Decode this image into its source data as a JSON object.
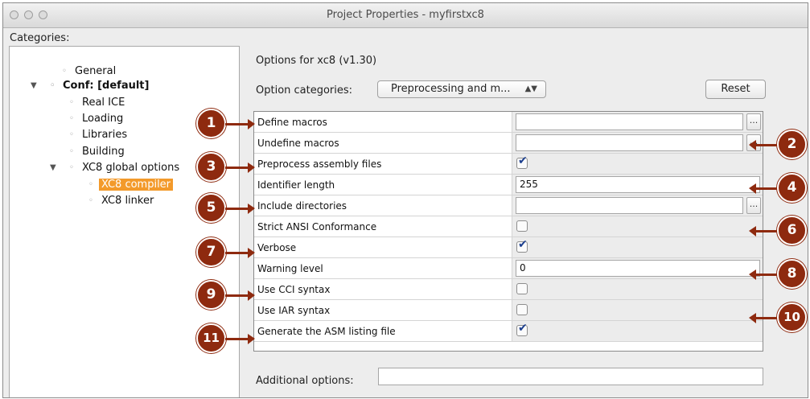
{
  "window": {
    "title": "Project Properties - myfirstxc8"
  },
  "categories": {
    "label": "Categories:",
    "items": [
      {
        "label": "General"
      },
      {
        "label": "Conf: [default]"
      },
      {
        "label": "Real ICE"
      },
      {
        "label": "Loading"
      },
      {
        "label": "Libraries"
      },
      {
        "label": "Building"
      },
      {
        "label": "XC8 global options"
      },
      {
        "label": "XC8 compiler"
      },
      {
        "label": "XC8 linker"
      }
    ]
  },
  "options": {
    "header": "Options for xc8 (v1.30)",
    "category_label": "Option categories:",
    "category_value": "Preprocessing and m...",
    "reset_label": "Reset",
    "rows": [
      {
        "label": "Define macros",
        "value": ""
      },
      {
        "label": "Undefine macros",
        "value": ""
      },
      {
        "label": "Preprocess assembly files",
        "checked": true
      },
      {
        "label": "Identifier length",
        "value": "255"
      },
      {
        "label": "Include directories",
        "value": ""
      },
      {
        "label": "Strict ANSI Conformance",
        "checked": false
      },
      {
        "label": "Verbose",
        "checked": true
      },
      {
        "label": "Warning level",
        "value": "0"
      },
      {
        "label": "Use CCI syntax",
        "checked": false
      },
      {
        "label": "Use IAR syntax",
        "checked": false
      },
      {
        "label": "Generate the ASM listing file",
        "checked": true
      }
    ],
    "browse_label": "...",
    "additional_label": "Additional options:",
    "additional_value": ""
  },
  "callouts": [
    "1",
    "2",
    "3",
    "4",
    "5",
    "6",
    "7",
    "8",
    "9",
    "10",
    "11"
  ],
  "colors": {
    "callout": "#8e2a0f",
    "selection": "#f39a2b",
    "check": "#1c3f8f"
  }
}
